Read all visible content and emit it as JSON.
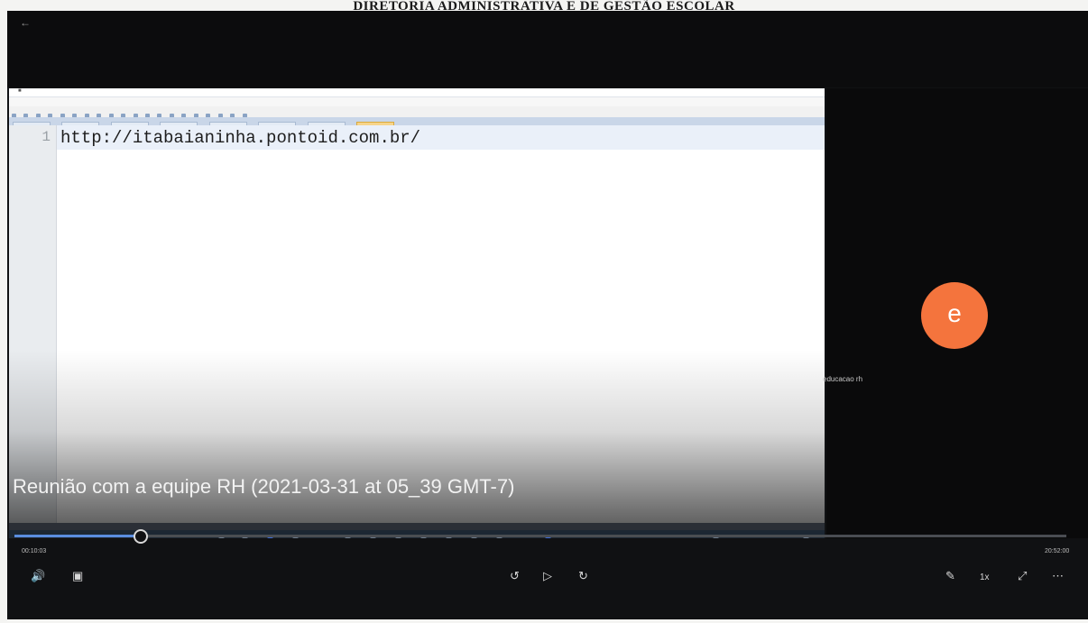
{
  "header": {
    "title": "DIRETORIA ADMINISTRATIVA E DE GESTÃO ESCOLAR"
  },
  "player": {
    "meeting_title": "Reunião com a equipe RH (2021-03-31 at 05_39 GMT-7)",
    "elapsed": "00:10:03",
    "duration": "20:52:00",
    "progress": 0.12,
    "speed_label": "1x",
    "icons": {
      "back": "back-arrow-icon",
      "volume": "volume-icon",
      "captions": "captions-icon",
      "rewind": "rewind-10-icon",
      "play": "play-icon",
      "forward": "forward-30-icon",
      "edit": "pen-icon",
      "fullscreen": "fullscreen-icon",
      "more": "more-options-icon"
    }
  },
  "shared_screen": {
    "editor": {
      "line_number": "1",
      "code": "http://itabaianinha.pontoid.com.br/"
    }
  },
  "participant": {
    "initial": "e",
    "name": "educacao rh",
    "avatar_color": "#f4743d"
  },
  "colors": {
    "accent": "#5a8de0",
    "background": "#111214"
  }
}
